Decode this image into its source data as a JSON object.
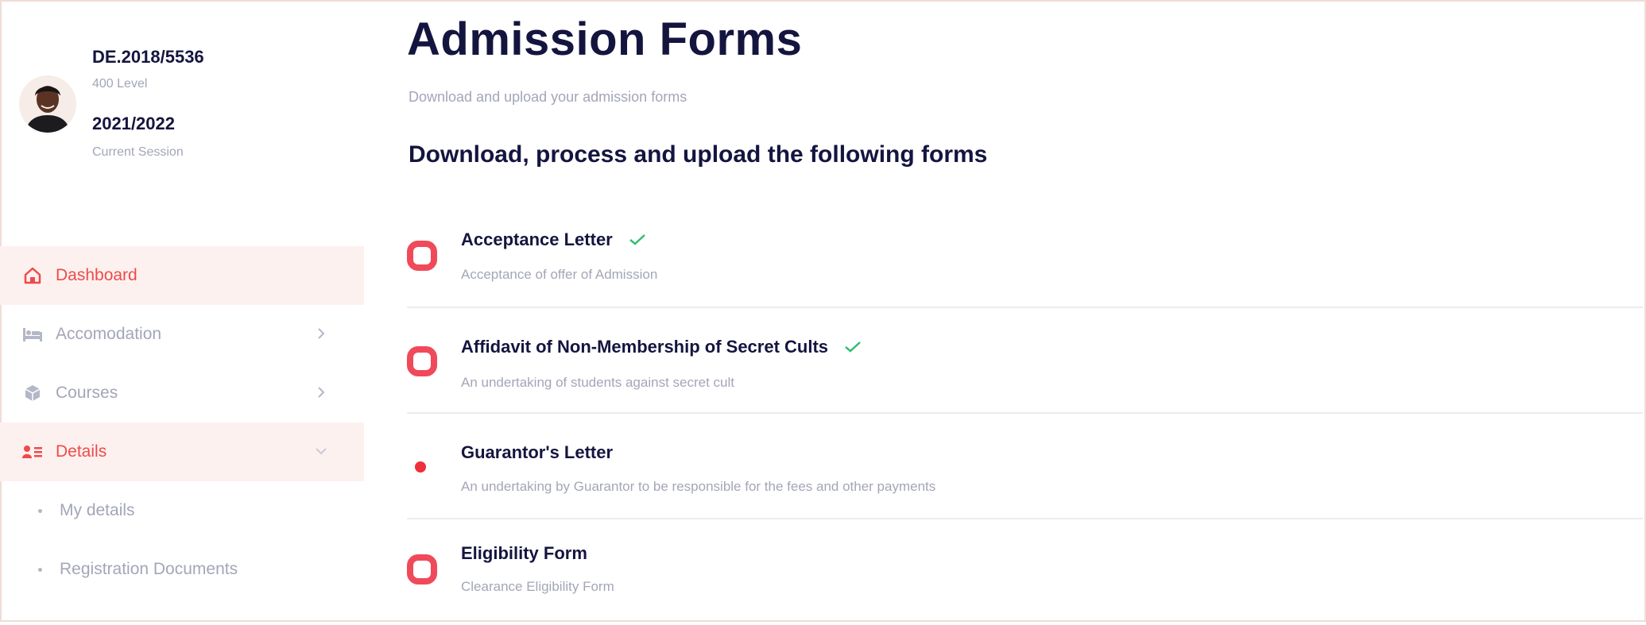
{
  "profile": {
    "id": "DE.2018/5536",
    "level": "400 Level",
    "session": "2021/2022",
    "session_label": "Current Session"
  },
  "nav": {
    "dashboard": "Dashboard",
    "accomodation": "Accomodation",
    "courses": "Courses",
    "details": "Details",
    "my_details": "My details",
    "registration_documents": "Registration Documents"
  },
  "main": {
    "title": "Admission Forms",
    "subtitle": "Download and upload your admission forms",
    "section_title": "Download, process and upload the following forms"
  },
  "forms": [
    {
      "title": "Acceptance Letter",
      "desc": "Acceptance of offer of Admission",
      "completed": true
    },
    {
      "title": "Affidavit of Non-Membership of Secret Cults",
      "desc": "An undertaking of students against secret cult",
      "completed": true
    },
    {
      "title": "Guarantor's Letter",
      "desc": "An undertaking by Guarantor to be responsible for the fees and other payments",
      "completed": false
    },
    {
      "title": "Eligibility Form",
      "desc": "Clearance Eligibility Form",
      "completed": false
    }
  ],
  "colors": {
    "accent": "#ef4a4a",
    "navy": "#14153f",
    "muted": "#a3a6b8",
    "check": "#2fbf71"
  },
  "icons": [
    "home-icon",
    "bed-icon",
    "cube-icon",
    "user-list-icon",
    "chevron-right-icon",
    "chevron-down-icon",
    "check-icon"
  ]
}
